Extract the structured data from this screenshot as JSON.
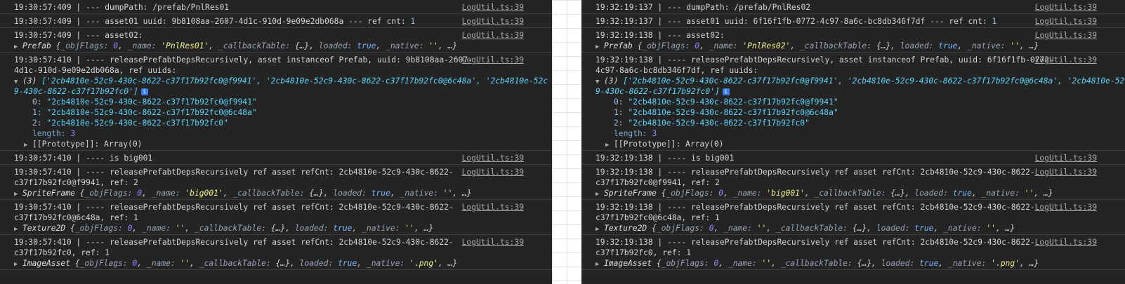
{
  "source_label": "LogUtil.ts:39",
  "left": {
    "lines": {
      "l0": "19:30:57:409 | --- dumpPath: /prefab/PnlRes01",
      "l1a": "19:30:57:409 | --- asset01 uuid: 9b8108aa-2607-4d1c-910d-9e09e2db068a --- ref cnt: ",
      "l1b": "1",
      "l2": "19:30:57:409 | --- asset02:",
      "l3cls": "Prefab",
      "l3name": "'PnlRes01'",
      "l4a": "19:30:57:410 | ---- releasePrefabtDepsRecursively, asset instanceof Prefab, uuid: 9b8108aa-2607-",
      "l4b": "4d1c-910d-9e09e2db068a, ref uuids:",
      "arr_count": "(3)",
      "arr1": "['2cb4810e-52c9-430c-8622-c37f17b92fc0@f9941', '2cb4810e-52c9-430c-8622-c37f17b92fc0@6c48a', '2cb4810e-52c",
      "arr2": "9-430c-8622-c37f17b92fc0']",
      "item0": "\"2cb4810e-52c9-430c-8622-c37f17b92fc0@f9941\"",
      "item1": "\"2cb4810e-52c9-430c-8622-c37f17b92fc0@6c48a\"",
      "item2": "\"2cb4810e-52c9-430c-8622-c37f17b92fc0\"",
      "l5": "19:30:57:410 | ---- is big001",
      "l6a": "19:30:57:410 | ---- releasePrefabtDepsRecursively ref asset refCnt: 2cb4810e-52c9-430c-8622-",
      "l6b": "c37f17b92fc0@f9941, ref: 2",
      "l6cls": "SpriteFrame",
      "l6name": "'big001'",
      "l7a": "19:30:57:410 | ---- releasePrefabtDepsRecursively ref asset refCnt: 2cb4810e-52c9-430c-8622-",
      "l7b": "c37f17b92fc0@6c48a, ref: 1",
      "l7cls": "Texture2D",
      "l8a": "19:30:57:410 | ---- releasePrefabtDepsRecursively ref asset refCnt: 2cb4810e-52c9-430c-8622-",
      "l8b": "c37f17b92fc0, ref: 1",
      "l8cls": "ImageAsset"
    }
  },
  "right": {
    "lines": {
      "l0": "19:32:19:137 | --- dumpPath: /prefab/PnlRes02",
      "l1a": "19:32:19:137 | --- asset01 uuid: 6f16f1fb-0772-4c97-8a6c-bc8db346f7df --- ref cnt: ",
      "l1b": "1",
      "l2": "19:32:19:138 | --- asset02:",
      "l3cls": "Prefab",
      "l3name": "'PnlRes02'",
      "l4a": "19:32:19:138 | ---- releasePrefabtDepsRecursively, asset instanceof Prefab, uuid: 6f16f1fb-0772-",
      "l4b": "4c97-8a6c-bc8db346f7df, ref uuids:",
      "arr_count": "(3)",
      "arr1": "['2cb4810e-52c9-430c-8622-c37f17b92fc0@f9941', '2cb4810e-52c9-430c-8622-c37f17b92fc0@6c48a', '2cb4810e-52c",
      "arr2": "9-430c-8622-c37f17b92fc0']",
      "item0": "\"2cb4810e-52c9-430c-8622-c37f17b92fc0@f9941\"",
      "item1": "\"2cb4810e-52c9-430c-8622-c37f17b92fc0@6c48a\"",
      "item2": "\"2cb4810e-52c9-430c-8622-c37f17b92fc0\"",
      "l5": "19:32:19:138 | ---- is big001",
      "l6a": "19:32:19:138 | ---- releasePrefabtDepsRecursively ref asset refCnt: 2cb4810e-52c9-430c-8622-",
      "l6b": "c37f17b92fc0@f9941, ref: 2",
      "l6cls": "SpriteFrame",
      "l6name": "'big001'",
      "l7a": "19:32:19:138 | ---- releasePrefabtDepsRecursively ref asset refCnt: 2cb4810e-52c9-430c-8622-",
      "l7b": "c37f17b92fc0@6c48a, ref: 1",
      "l7cls": "Texture2D",
      "l8a": "19:32:19:138 | ---- releasePrefabtDepsRecursively ref asset refCnt: 2cb4810e-52c9-430c-8622-",
      "l8b": "c37f17b92fc0, ref: 1",
      "l8cls": "ImageAsset"
    }
  },
  "common": {
    "objflags_key": "_objFlags:",
    "objflags_val": "0",
    "name_key": "_name:",
    "empty_str": "''",
    "cbt_key": "_callbackTable:",
    "cbt_val": "{…}",
    "loaded_key": "loaded:",
    "loaded_val": "true",
    "native_key": "_native:",
    "png_str": "'.png'",
    "ellipsis": "…}",
    "open_brace": "{",
    "sep": ",",
    "idx0": "0:",
    "idx1": "1:",
    "idx2": "2:",
    "length_key": "length:",
    "length_val": "3",
    "proto": "[[Prototype]]: Array(0)",
    "info_glyph": "i",
    "expand_glyph": "▶",
    "collapse_glyph": "▼"
  }
}
